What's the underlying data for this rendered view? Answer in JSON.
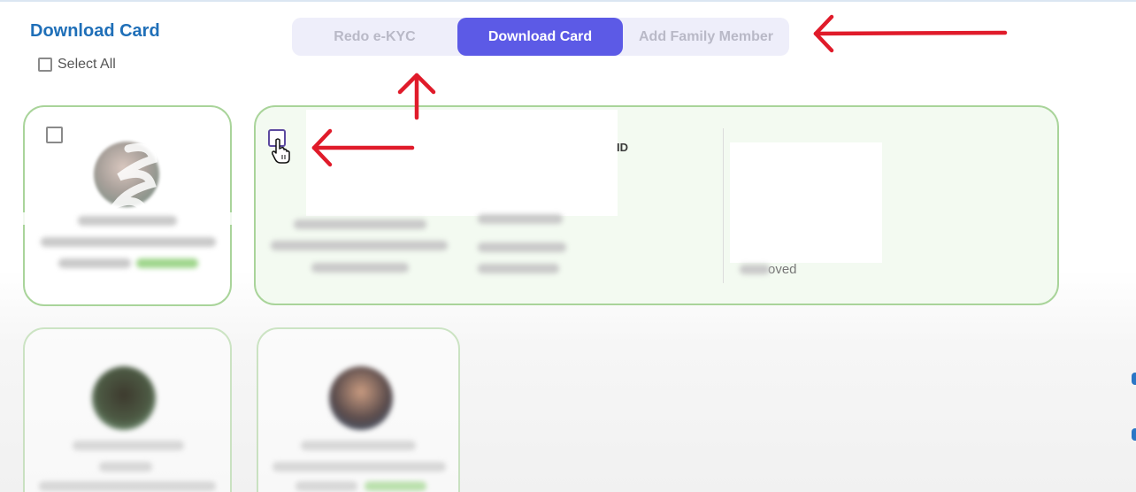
{
  "page": {
    "title": "Download Card",
    "select_all_label": "Select All"
  },
  "tabs": [
    {
      "label": "Redo e-KYC",
      "active": false
    },
    {
      "label": "Download Card",
      "active": true
    },
    {
      "label": "Add Family Member",
      "active": false
    }
  ],
  "selected_card": {
    "id_label": "ID",
    "status_fragment": "oved"
  },
  "colors": {
    "accent": "#5c5ae6",
    "title_blue": "#1f6fb8",
    "card_border": "#a9d49a",
    "annotation_red": "#e01b2a"
  },
  "icons": {
    "cursor": "hand-pointer-icon",
    "annotation": "red-arrow"
  }
}
